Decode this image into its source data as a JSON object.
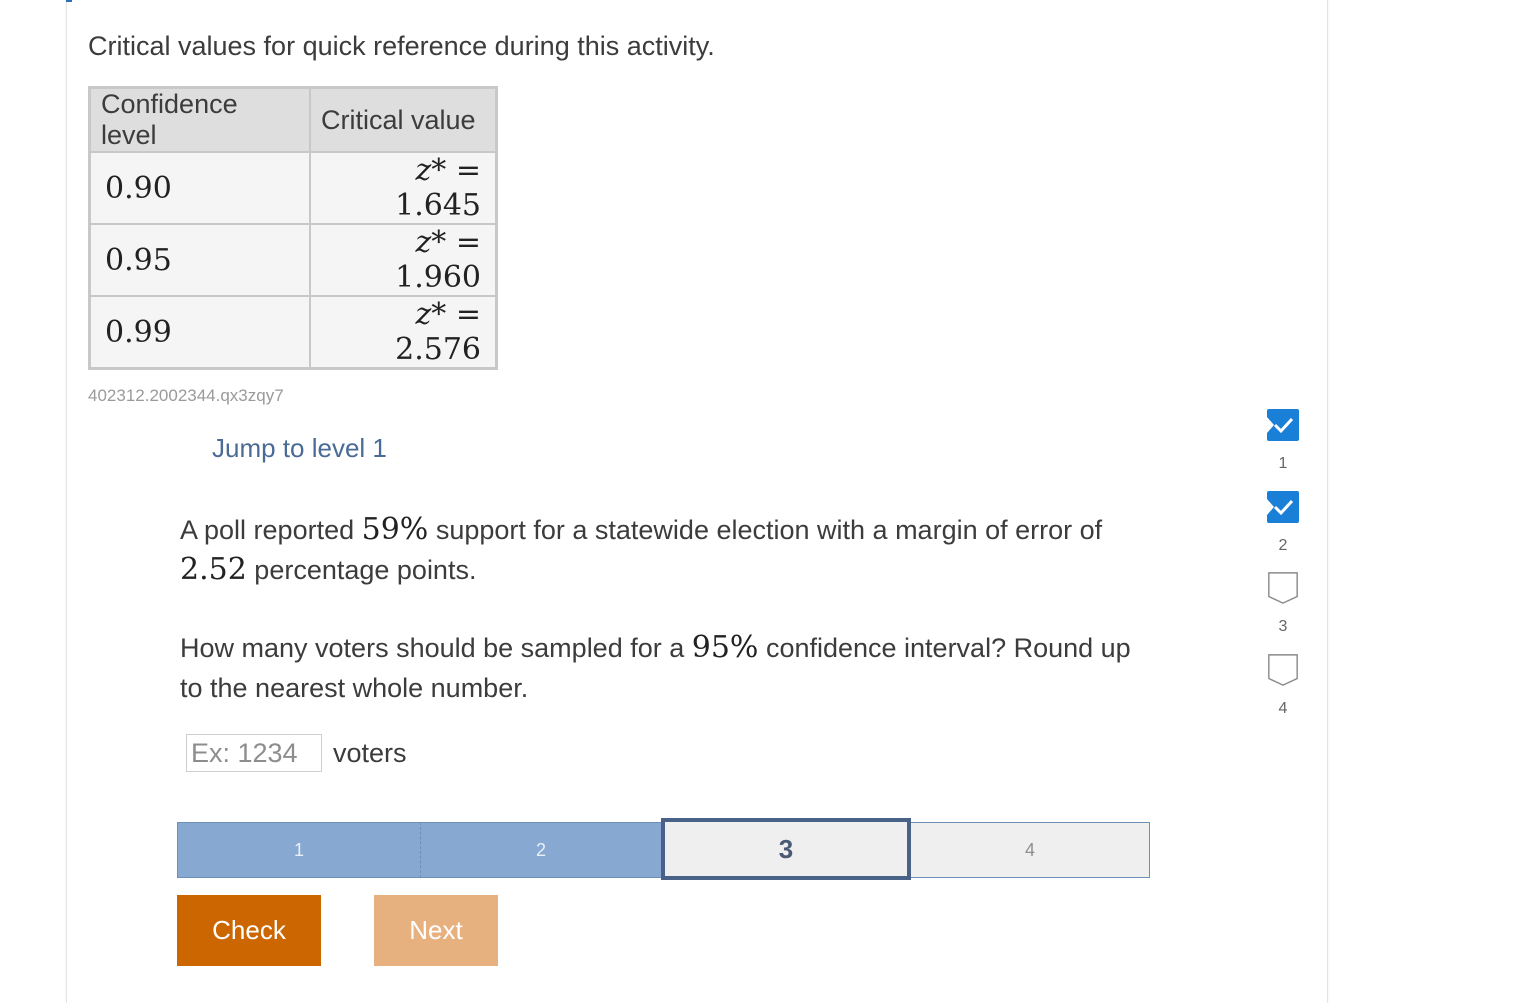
{
  "intro_text": "Critical values for quick reference during this activity.",
  "table": {
    "headers": [
      "Confidence level",
      "Critical value"
    ],
    "rows": [
      {
        "level": "0.90",
        "z_symbol": "z*",
        "equals": "=",
        "value": "1.645"
      },
      {
        "level": "0.95",
        "z_symbol": "z*",
        "equals": "=",
        "value": "1.960"
      },
      {
        "level": "0.99",
        "z_symbol": "z*",
        "equals": "=",
        "value": "2.576"
      }
    ]
  },
  "activity_code": "402312.2002344.qx3zqy7",
  "jump_link": "Jump to level 1",
  "question": {
    "p1_a": "A poll reported ",
    "p1_support": "59%",
    "p1_b": " support for a statewide election with a margin of error of ",
    "p1_margin": "2.52",
    "p1_c": " percentage points.",
    "p2_a": "How many voters should be sampled for a ",
    "p2_conf": "95%",
    "p2_b": " confidence interval? Round up to the nearest whole number."
  },
  "answer": {
    "value": "",
    "placeholder": "Ex: 1234",
    "unit": "voters"
  },
  "level_bar": {
    "levels": [
      "1",
      "2",
      "3",
      "4"
    ],
    "completed": [
      1,
      2
    ],
    "current": 3
  },
  "buttons": {
    "check": "Check",
    "next": "Next"
  },
  "side_nav": [
    {
      "label": "1",
      "status": "completed"
    },
    {
      "label": "2",
      "status": "completed"
    },
    {
      "label": "3",
      "status": "incomplete"
    },
    {
      "label": "4",
      "status": "incomplete"
    }
  ],
  "colors": {
    "check_button": "#cc6600",
    "next_button": "#e7b07f",
    "completed_level": "#87a9d1",
    "current_level_border": "#4a6288",
    "nav_check": "#1a7fd6",
    "link": "#4a6b96"
  }
}
